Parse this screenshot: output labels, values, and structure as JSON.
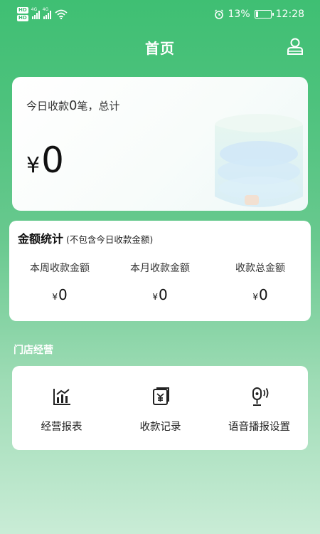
{
  "status_bar": {
    "left_icons": [
      "hd-icon",
      "hd-icon",
      "signal-icon",
      "signal-icon",
      "wifi-icon"
    ],
    "signal_tag": "4G",
    "battery_percent_text": "13%",
    "battery_level": 0.13,
    "time": "12:28"
  },
  "nav": {
    "title": "首页",
    "right_icon": "user-icon"
  },
  "hero": {
    "prefix": "今日收款",
    "count": "0",
    "suffix": "笔，总计",
    "currency": "¥",
    "amount": "0"
  },
  "stats": {
    "title": "金额统计",
    "note": "(不包含今日收款金额)",
    "items": [
      {
        "label": "本周收款金额",
        "currency": "¥",
        "value": "0"
      },
      {
        "label": "本月收款金额",
        "currency": "¥",
        "value": "0"
      },
      {
        "label": "收款总金额",
        "currency": "¥",
        "value": "0"
      }
    ]
  },
  "store": {
    "title": "门店经营",
    "items": [
      {
        "label": "经营报表",
        "icon": "chart-report-icon"
      },
      {
        "label": "收款记录",
        "icon": "receipt-record-icon"
      },
      {
        "label": "语音播报设置",
        "icon": "voice-broadcast-icon"
      }
    ]
  },
  "colors": {
    "brand_green": "#3fbf73",
    "card_bg": "#ffffff"
  }
}
